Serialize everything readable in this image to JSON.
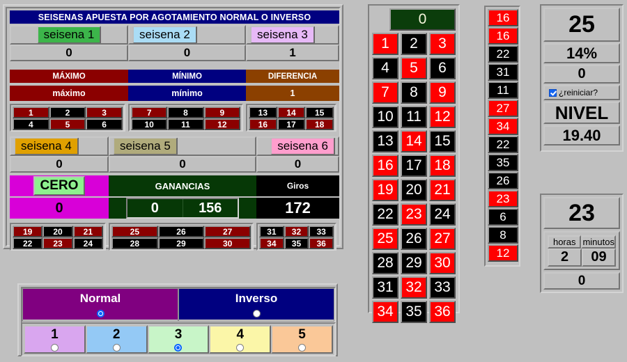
{
  "main_panel": {
    "title": "SEISENAS APUESTA POR AGOTAMIENTO NORMAL O INVERSO",
    "seisenas_top": [
      {
        "label": "seisena 1",
        "count": "0",
        "bg": "#3cb54a",
        "align": "center"
      },
      {
        "label": "seisena 2",
        "count": "0",
        "bg": "#aadcf5",
        "align": "left"
      },
      {
        "label": "seisena 3",
        "count": "1",
        "bg": "#e7b9f7",
        "align": "left"
      }
    ],
    "bands_top": [
      {
        "title": "MÁXIMO",
        "value": "máximo",
        "bg": "#8b0000"
      },
      {
        "title": "MÍNIMO",
        "value": "mínimo",
        "bg": "#000080"
      },
      {
        "title": "DIFERENCIA",
        "value": "1",
        "bg": "#8b4000"
      }
    ],
    "numbers_top": [
      {
        "rows": [
          [
            {
              "n": "1",
              "c": "drd"
            },
            {
              "n": "2",
              "c": "blk"
            },
            {
              "n": "3",
              "c": "drd"
            }
          ],
          [
            {
              "n": "4",
              "c": "blk"
            },
            {
              "n": "5",
              "c": "drd"
            },
            {
              "n": "6",
              "c": "blk"
            }
          ]
        ]
      },
      {
        "rows": [
          [
            {
              "n": "7",
              "c": "drd"
            },
            {
              "n": "8",
              "c": "blk"
            },
            {
              "n": "9",
              "c": "drd"
            }
          ],
          [
            {
              "n": "10",
              "c": "blk"
            },
            {
              "n": "11",
              "c": "blk"
            },
            {
              "n": "12",
              "c": "drd"
            }
          ]
        ]
      },
      {
        "rows": [
          [
            {
              "n": "13",
              "c": "blk"
            },
            {
              "n": "14",
              "c": "drd"
            },
            {
              "n": "15",
              "c": "blk"
            }
          ],
          [
            {
              "n": "16",
              "c": "drd"
            },
            {
              "n": "17",
              "c": "blk"
            },
            {
              "n": "18",
              "c": "drd"
            }
          ]
        ]
      }
    ],
    "seisenas_bottom": [
      {
        "label": "seisena 4",
        "count": "0",
        "bg": "#e0a000",
        "align": "left"
      },
      {
        "label": "seisena 5",
        "count": "0",
        "bg": "#b0ab7c",
        "align": "left"
      },
      {
        "label": "seisena 6",
        "count": "0",
        "bg": "#ff9ecd",
        "align": "right"
      }
    ],
    "bands_bottom": [
      {
        "title": "CERO",
        "value": "0",
        "bg": "#d800d8",
        "tag": true
      },
      {
        "title": "GANANCIAS",
        "value_a": "0",
        "value_b": "156",
        "bg": "#063806"
      },
      {
        "title": "Giros",
        "value": "172",
        "bg": "#000000"
      }
    ],
    "numbers_bottom": [
      {
        "rows": [
          [
            {
              "n": "19",
              "c": "drd"
            },
            {
              "n": "20",
              "c": "blk"
            },
            {
              "n": "21",
              "c": "drd"
            }
          ],
          [
            {
              "n": "22",
              "c": "blk"
            },
            {
              "n": "23",
              "c": "drd"
            },
            {
              "n": "24",
              "c": "blk"
            }
          ]
        ]
      },
      {
        "rows": [
          [
            {
              "n": "25",
              "c": "drd"
            },
            {
              "n": "26",
              "c": "blk"
            },
            {
              "n": "27",
              "c": "drd"
            }
          ],
          [
            {
              "n": "28",
              "c": "blk"
            },
            {
              "n": "29",
              "c": "blk"
            },
            {
              "n": "30",
              "c": "drd"
            }
          ]
        ]
      },
      {
        "rows": [
          [
            {
              "n": "31",
              "c": "blk"
            },
            {
              "n": "32",
              "c": "drd"
            },
            {
              "n": "33",
              "c": "blk"
            }
          ],
          [
            {
              "n": "34",
              "c": "drd"
            },
            {
              "n": "35",
              "c": "blk"
            },
            {
              "n": "36",
              "c": "drd"
            }
          ]
        ]
      }
    ]
  },
  "board": {
    "zero": {
      "n": "0",
      "color": "green"
    },
    "rows": [
      [
        {
          "n": "1",
          "c": "red"
        },
        {
          "n": "2",
          "c": "blk"
        },
        {
          "n": "3",
          "c": "red"
        }
      ],
      [
        {
          "n": "4",
          "c": "blk"
        },
        {
          "n": "5",
          "c": "red"
        },
        {
          "n": "6",
          "c": "blk"
        }
      ],
      [
        {
          "n": "7",
          "c": "red"
        },
        {
          "n": "8",
          "c": "blk"
        },
        {
          "n": "9",
          "c": "red"
        }
      ],
      [
        {
          "n": "10",
          "c": "blk"
        },
        {
          "n": "11",
          "c": "blk"
        },
        {
          "n": "12",
          "c": "red"
        }
      ],
      [
        {
          "n": "13",
          "c": "blk"
        },
        {
          "n": "14",
          "c": "red"
        },
        {
          "n": "15",
          "c": "blk"
        }
      ],
      [
        {
          "n": "16",
          "c": "red"
        },
        {
          "n": "17",
          "c": "blk"
        },
        {
          "n": "18",
          "c": "red"
        }
      ],
      [
        {
          "n": "19",
          "c": "red"
        },
        {
          "n": "20",
          "c": "blk"
        },
        {
          "n": "21",
          "c": "red"
        }
      ],
      [
        {
          "n": "22",
          "c": "blk"
        },
        {
          "n": "23",
          "c": "red"
        },
        {
          "n": "24",
          "c": "blk"
        }
      ],
      [
        {
          "n": "25",
          "c": "red"
        },
        {
          "n": "26",
          "c": "blk"
        },
        {
          "n": "27",
          "c": "red"
        }
      ],
      [
        {
          "n": "28",
          "c": "blk"
        },
        {
          "n": "29",
          "c": "blk"
        },
        {
          "n": "30",
          "c": "red"
        }
      ],
      [
        {
          "n": "31",
          "c": "blk"
        },
        {
          "n": "32",
          "c": "red"
        },
        {
          "n": "33",
          "c": "blk"
        }
      ],
      [
        {
          "n": "34",
          "c": "red"
        },
        {
          "n": "35",
          "c": "blk"
        },
        {
          "n": "36",
          "c": "red"
        }
      ]
    ]
  },
  "history": [
    {
      "n": "16",
      "c": "red"
    },
    {
      "n": "16",
      "c": "red"
    },
    {
      "n": "22",
      "c": "blk"
    },
    {
      "n": "31",
      "c": "blk"
    },
    {
      "n": "11",
      "c": "blk"
    },
    {
      "n": "27",
      "c": "red"
    },
    {
      "n": "34",
      "c": "red"
    },
    {
      "n": "22",
      "c": "blk"
    },
    {
      "n": "35",
      "c": "blk"
    },
    {
      "n": "26",
      "c": "blk"
    },
    {
      "n": "23",
      "c": "red"
    },
    {
      "n": "6",
      "c": "blk"
    },
    {
      "n": "8",
      "c": "blk"
    },
    {
      "n": "12",
      "c": "red"
    }
  ],
  "stats": {
    "big": "25",
    "percent": "14%",
    "zero_value": "0",
    "reset_label": "¿reiniciar?",
    "reset_checked": true,
    "level_label": "NIVEL",
    "level_value": "19.40"
  },
  "clock": {
    "big": "23",
    "hours_label": "horas",
    "minutes_label": "minutos",
    "hours_value": "2",
    "minutes_value": "09",
    "bottom_value": "0"
  },
  "mode": {
    "options": [
      {
        "label": "Normal",
        "selected": true
      },
      {
        "label": "Inverso",
        "selected": false
      }
    ],
    "levels": [
      {
        "label": "1",
        "bg": "#d9a6ef",
        "selected": false
      },
      {
        "label": "2",
        "bg": "#94c9f5",
        "selected": false
      },
      {
        "label": "3",
        "bg": "#c8f5c8",
        "selected": true
      },
      {
        "label": "4",
        "bg": "#fbf6a8",
        "selected": false
      },
      {
        "label": "5",
        "bg": "#fac898",
        "selected": false
      }
    ]
  }
}
